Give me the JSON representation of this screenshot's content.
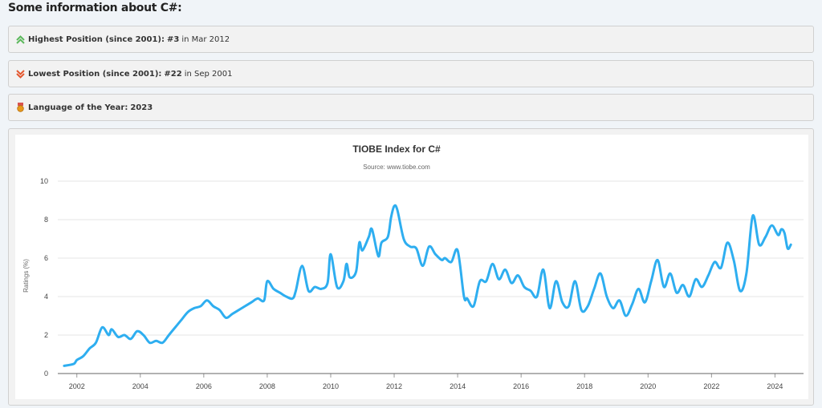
{
  "heading": "Some information about C#:",
  "info": [
    {
      "icon": "double-chevron-up-icon",
      "label": "Highest Position (since 2001):",
      "value": "#3",
      "suffix": "in Mar 2012"
    },
    {
      "icon": "double-chevron-down-icon",
      "label": "Lowest Position (since 2001):",
      "value": "#22",
      "suffix": "in Sep 2001"
    },
    {
      "icon": "award-medal-icon",
      "label": "Language of the Year:",
      "value": "2023",
      "suffix": ""
    }
  ],
  "colors": {
    "line": "#2eaef0",
    "up": "#5cb85c",
    "down": "#e4572e",
    "medal": "#e89a1c"
  },
  "chart_data": {
    "type": "line",
    "title": "TIOBE Index for C#",
    "subtitle": "Source: www.tiobe.com",
    "xlabel": "",
    "ylabel": "Ratings (%)",
    "xlim": [
      2001.4,
      2024.9
    ],
    "ylim": [
      0,
      10
    ],
    "xticks": [
      2002,
      2004,
      2006,
      2008,
      2010,
      2012,
      2014,
      2016,
      2018,
      2020,
      2022,
      2024
    ],
    "yticks": [
      0,
      2,
      4,
      6,
      8,
      10
    ],
    "grid": true,
    "series": [
      {
        "name": "",
        "x": [
          2001.6,
          2001.9,
          2002.0,
          2002.2,
          2002.4,
          2002.6,
          2002.8,
          2003.0,
          2003.1,
          2003.3,
          2003.5,
          2003.7,
          2003.9,
          2004.1,
          2004.3,
          2004.5,
          2004.7,
          2004.9,
          2005.1,
          2005.3,
          2005.5,
          2005.7,
          2005.9,
          2006.1,
          2006.3,
          2006.5,
          2006.7,
          2006.9,
          2007.1,
          2007.3,
          2007.5,
          2007.7,
          2007.9,
          2008.0,
          2008.2,
          2008.4,
          2008.6,
          2008.8,
          2008.9,
          2009.1,
          2009.3,
          2009.5,
          2009.7,
          2009.9,
          2010.0,
          2010.2,
          2010.4,
          2010.5,
          2010.6,
          2010.8,
          2010.9,
          2011.0,
          2011.2,
          2011.3,
          2011.5,
          2011.6,
          2011.8,
          2011.9,
          2012.0,
          2012.1,
          2012.3,
          2012.5,
          2012.7,
          2012.9,
          2013.1,
          2013.3,
          2013.5,
          2013.6,
          2013.8,
          2014.0,
          2014.2,
          2014.3,
          2014.5,
          2014.7,
          2014.9,
          2015.1,
          2015.3,
          2015.5,
          2015.7,
          2015.9,
          2016.1,
          2016.3,
          2016.5,
          2016.7,
          2016.9,
          2017.1,
          2017.3,
          2017.5,
          2017.7,
          2017.9,
          2018.1,
          2018.3,
          2018.5,
          2018.7,
          2018.9,
          2019.1,
          2019.3,
          2019.5,
          2019.7,
          2019.9,
          2020.1,
          2020.3,
          2020.5,
          2020.7,
          2020.9,
          2021.1,
          2021.3,
          2021.5,
          2021.7,
          2021.9,
          2022.1,
          2022.3,
          2022.5,
          2022.7,
          2022.9,
          2023.1,
          2023.3,
          2023.5,
          2023.7,
          2023.9,
          2024.1,
          2024.2,
          2024.3,
          2024.4,
          2024.5
        ],
        "y": [
          0.4,
          0.5,
          0.7,
          0.9,
          1.3,
          1.6,
          2.4,
          2.0,
          2.3,
          1.9,
          2.0,
          1.8,
          2.2,
          2.0,
          1.6,
          1.7,
          1.6,
          2.0,
          2.4,
          2.8,
          3.2,
          3.4,
          3.5,
          3.8,
          3.5,
          3.3,
          2.9,
          3.1,
          3.3,
          3.5,
          3.7,
          3.9,
          3.8,
          4.8,
          4.4,
          4.2,
          4.0,
          3.9,
          4.3,
          5.6,
          4.3,
          4.5,
          4.4,
          4.7,
          6.2,
          4.5,
          4.8,
          5.7,
          5.0,
          5.3,
          6.8,
          6.4,
          7.1,
          7.5,
          6.1,
          6.8,
          7.1,
          8.1,
          8.7,
          8.5,
          7.0,
          6.6,
          6.5,
          5.6,
          6.6,
          6.2,
          5.9,
          6.0,
          5.8,
          6.4,
          4.0,
          3.9,
          3.5,
          4.8,
          4.8,
          5.7,
          4.9,
          5.4,
          4.7,
          5.1,
          4.5,
          4.3,
          4.0,
          5.4,
          3.4,
          4.8,
          3.7,
          3.5,
          4.8,
          3.3,
          3.5,
          4.4,
          5.2,
          4.0,
          3.4,
          3.8,
          3.0,
          3.6,
          4.4,
          3.7,
          4.8,
          5.9,
          4.5,
          5.2,
          4.2,
          4.6,
          4.0,
          4.9,
          4.5,
          5.1,
          5.8,
          5.5,
          6.8,
          5.9,
          4.3,
          5.2,
          8.2,
          6.7,
          7.1,
          7.7,
          7.2,
          7.5,
          7.3,
          6.5,
          6.7
        ]
      }
    ]
  }
}
